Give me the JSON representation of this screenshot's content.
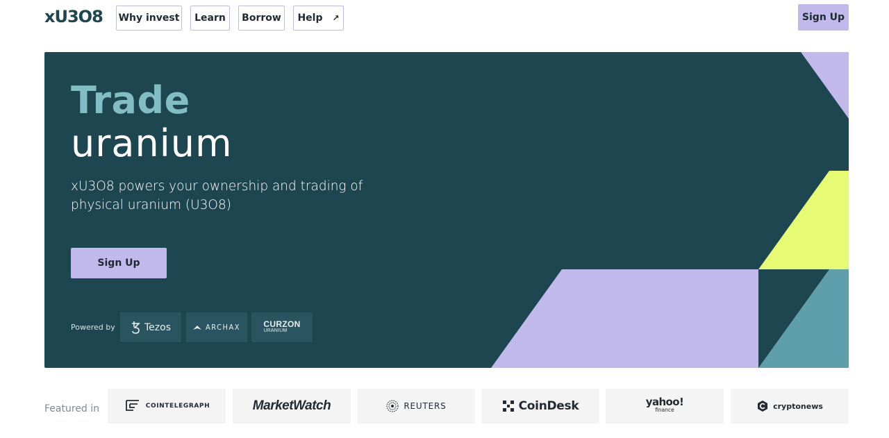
{
  "header": {
    "logo": "xU3O8",
    "nav": [
      {
        "label": "Why invest"
      },
      {
        "label": "Learn"
      },
      {
        "label": "Borrow"
      },
      {
        "label": "Help"
      }
    ],
    "signup_label": "Sign Up"
  },
  "hero": {
    "title_line1": "Trade",
    "title_line2": "uranium",
    "subtitle": "xU3O8 powers your ownership and trading of physical uranium (U3O8)",
    "cta_label": "Sign Up",
    "powered_by_label": "Powered by",
    "partners": [
      {
        "name": "Tezos"
      },
      {
        "name": "ARCHAX"
      },
      {
        "name": "CURZON",
        "sub": "URANIUM"
      }
    ]
  },
  "featured": {
    "label": "Featured in",
    "outlets": [
      {
        "name": "COINTELEGRAPH"
      },
      {
        "name": "MarketWatch"
      },
      {
        "name": "REUTERS"
      },
      {
        "name": "CoinDesk"
      },
      {
        "name": "yahoo!",
        "sub": "finance"
      },
      {
        "name": "cryptonews"
      }
    ]
  },
  "colors": {
    "hero_bg": "#1e4650",
    "lavender": "#c1b8eb",
    "lime": "#e6fa74",
    "teal": "#5f9fab",
    "title_teal": "#82bdc6"
  }
}
